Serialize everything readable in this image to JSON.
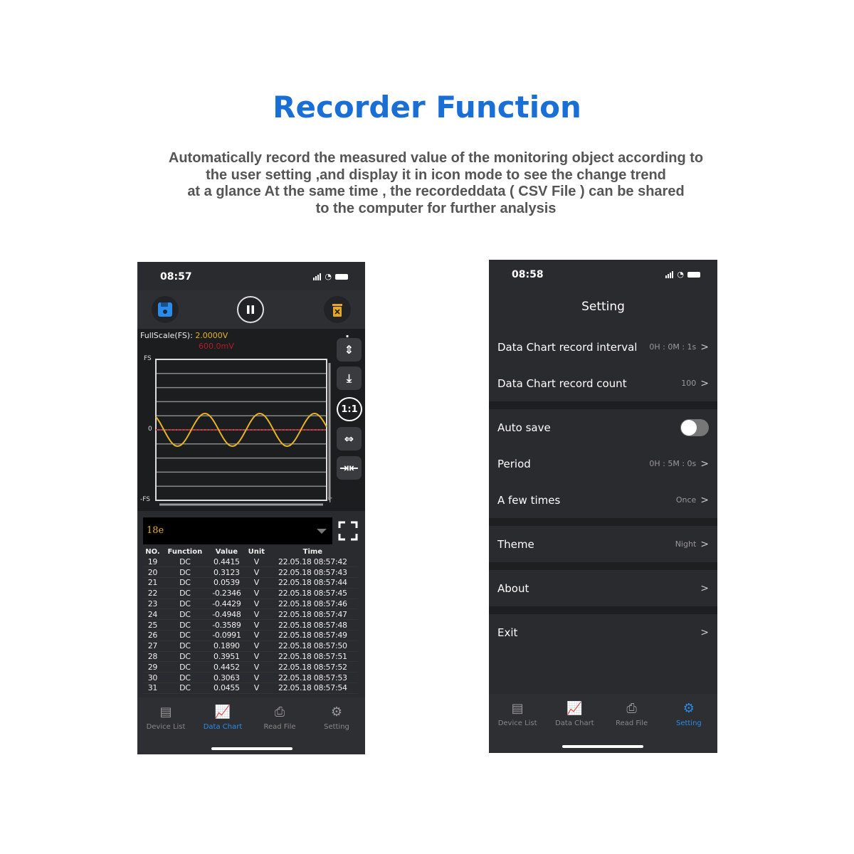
{
  "page": {
    "title": "Recorder Function",
    "description": [
      "Automatically record the measured value of the monitoring object according to",
      "the user setting ,and display it in icon mode to see the change trend",
      "at a glance At the same time , the recordeddata ( CSV File ) can be shared",
      "to the computer for further analysis"
    ]
  },
  "chart_screen": {
    "time": "08:57",
    "fullscale_label": "FullScale(FS):",
    "fullscale_value": "2.0000V",
    "secondary_value": "600.0mV",
    "axis": {
      "top": "FS",
      "zero": "0",
      "bottom": "-FS",
      "t": "T"
    },
    "zoom_label": "1:1",
    "dropdown_value": "18e",
    "colors": {
      "wave": "#e6b422",
      "zero_line": "#d0202a",
      "accent": "#2a8be8"
    },
    "table": {
      "headers": [
        "NO.",
        "Function",
        "Value",
        "Unit",
        "Time"
      ],
      "rows": [
        [
          "19",
          "DC",
          "0.4415",
          "V",
          "22.05.18 08:57:42"
        ],
        [
          "20",
          "DC",
          "0.3123",
          "V",
          "22.05.18 08:57:43"
        ],
        [
          "21",
          "DC",
          "0.0539",
          "V",
          "22.05.18 08:57:44"
        ],
        [
          "22",
          "DC",
          "-0.2346",
          "V",
          "22.05.18 08:57:45"
        ],
        [
          "23",
          "DC",
          "-0.4429",
          "V",
          "22.05.18 08:57:46"
        ],
        [
          "24",
          "DC",
          "-0.4948",
          "V",
          "22.05.18 08:57:47"
        ],
        [
          "25",
          "DC",
          "-0.3589",
          "V",
          "22.05.18 08:57:48"
        ],
        [
          "26",
          "DC",
          "-0.0991",
          "V",
          "22.05.18 08:57:49"
        ],
        [
          "27",
          "DC",
          "0.1890",
          "V",
          "22.05.18 08:57:50"
        ],
        [
          "28",
          "DC",
          "0.3951",
          "V",
          "22.05.18 08:57:51"
        ],
        [
          "29",
          "DC",
          "0.4452",
          "V",
          "22.05.18 08:57:52"
        ],
        [
          "30",
          "DC",
          "0.3063",
          "V",
          "22.05.18 08:57:53"
        ],
        [
          "31",
          "DC",
          "0.0455",
          "V",
          "22.05.18 08:57:54"
        ]
      ]
    }
  },
  "nav": [
    "Device List",
    "Data Chart",
    "Read File",
    "Setting"
  ],
  "settings_screen": {
    "time": "08:58",
    "title": "Setting",
    "items": [
      {
        "label": "Data Chart record interval",
        "value": "0H : 0M : 1s"
      },
      {
        "label": "Data Chart record count",
        "value": "100"
      },
      {
        "label": "Auto save",
        "toggle": false
      },
      {
        "label": "Period",
        "value": "0H : 5M : 0s"
      },
      {
        "label": "A few times",
        "value": "Once"
      },
      {
        "label": "Theme",
        "value": "Night"
      },
      {
        "label": "About",
        "value": ""
      },
      {
        "label": "Exit",
        "value": ""
      }
    ]
  }
}
